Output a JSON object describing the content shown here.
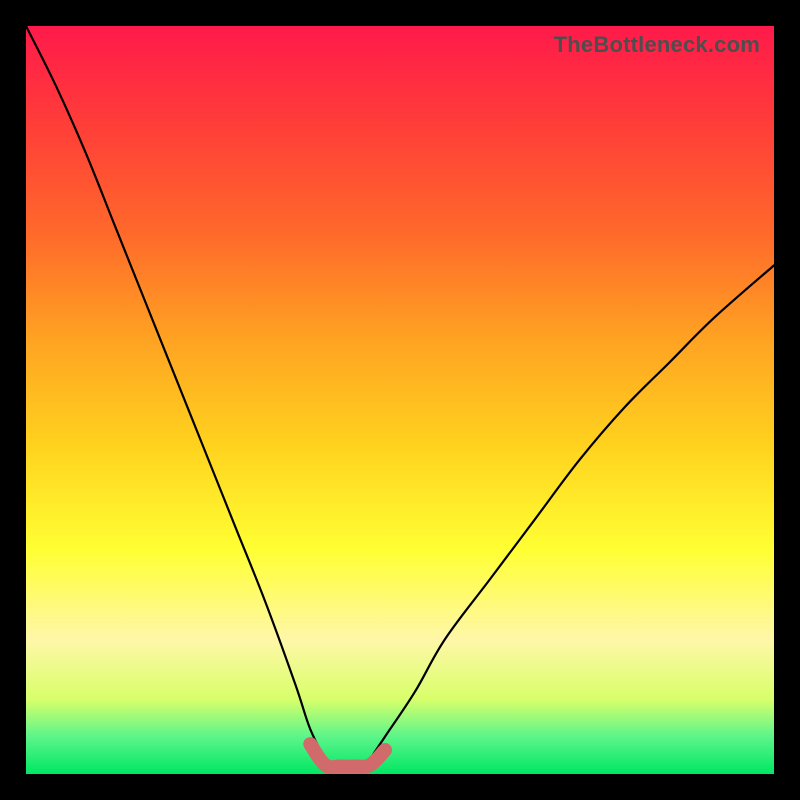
{
  "watermark": "TheBottleneck.com",
  "colors": {
    "background": "#000000",
    "curve": "#000000",
    "plateau": "#d16a6a",
    "gradient_top": "#ff1a4b",
    "gradient_bottom": "#00e765"
  },
  "chart_data": {
    "type": "line",
    "title": "",
    "xlabel": "",
    "ylabel": "",
    "xlim": [
      0,
      100
    ],
    "ylim": [
      0,
      100
    ],
    "grid": false,
    "legend": false,
    "description": "Bottleneck curve. Two black lines descend steeply from the top edges toward a shared minimum near x≈42, where a short salmon-colored plateau marks near-zero bottleneck; the right branch rises again toward x=100.",
    "series": [
      {
        "name": "left-branch",
        "x": [
          0,
          4,
          8,
          12,
          16,
          20,
          24,
          28,
          32,
          36,
          38,
          40
        ],
        "y": [
          100,
          92,
          83,
          73,
          63,
          53,
          43,
          33,
          23,
          12,
          6,
          2
        ]
      },
      {
        "name": "right-branch",
        "x": [
          46,
          48,
          52,
          56,
          62,
          68,
          74,
          80,
          86,
          92,
          100
        ],
        "y": [
          2,
          5,
          11,
          18,
          26,
          34,
          42,
          49,
          55,
          61,
          68
        ]
      },
      {
        "name": "plateau",
        "x": [
          38,
          40,
          42,
          44,
          46,
          48
        ],
        "y": [
          4,
          1.2,
          1.0,
          1.0,
          1.2,
          3.2
        ]
      }
    ]
  }
}
